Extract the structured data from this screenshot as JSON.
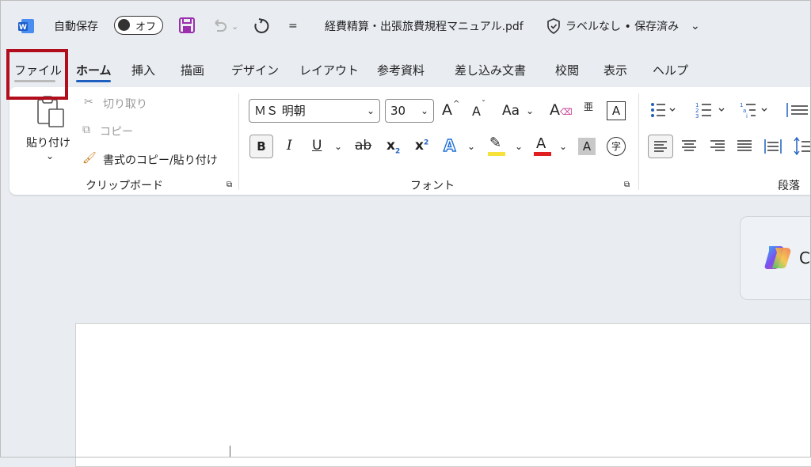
{
  "titlebar": {
    "autosave_label": "自動保存",
    "autosave_toggle": "オフ",
    "filename": "経費精算・出張旅費規程マニュアル.pdf",
    "label_status": "ラベルなし • 保存済み",
    "chevron": "⌄",
    "qat_more": "="
  },
  "tabs": [
    "ファイル",
    "ホーム",
    "挿入",
    "描画",
    "デザイン",
    "レイアウト",
    "参考資料",
    "差し込み文書",
    "校閲",
    "表示",
    "ヘルプ"
  ],
  "clipboard": {
    "paste_label": "貼り付け",
    "paste_arrow": "⌄",
    "cut_label": "切り取り",
    "copy_label": "コピー",
    "format_painter_label": "書式のコピー/貼り付け",
    "group_label": "クリップボード"
  },
  "font": {
    "font_name": "ＭＳ 明朝",
    "font_size": "30",
    "grow": "A",
    "shrink": "A",
    "case": "Aa",
    "bold": "B",
    "italic": "I",
    "underline": "U",
    "strike": "ab",
    "subscript": "x",
    "superscript": "x",
    "effects": "A",
    "font_color": "A",
    "shade": "A",
    "group_label": "フォント",
    "enclose": "字",
    "phonetic": "亜",
    "border": "A",
    "highlight_color": "#f7e13b",
    "font_color_value": "#e02020"
  },
  "paragraph": {
    "group_label": "段落"
  },
  "copilot": {
    "text": "C"
  }
}
